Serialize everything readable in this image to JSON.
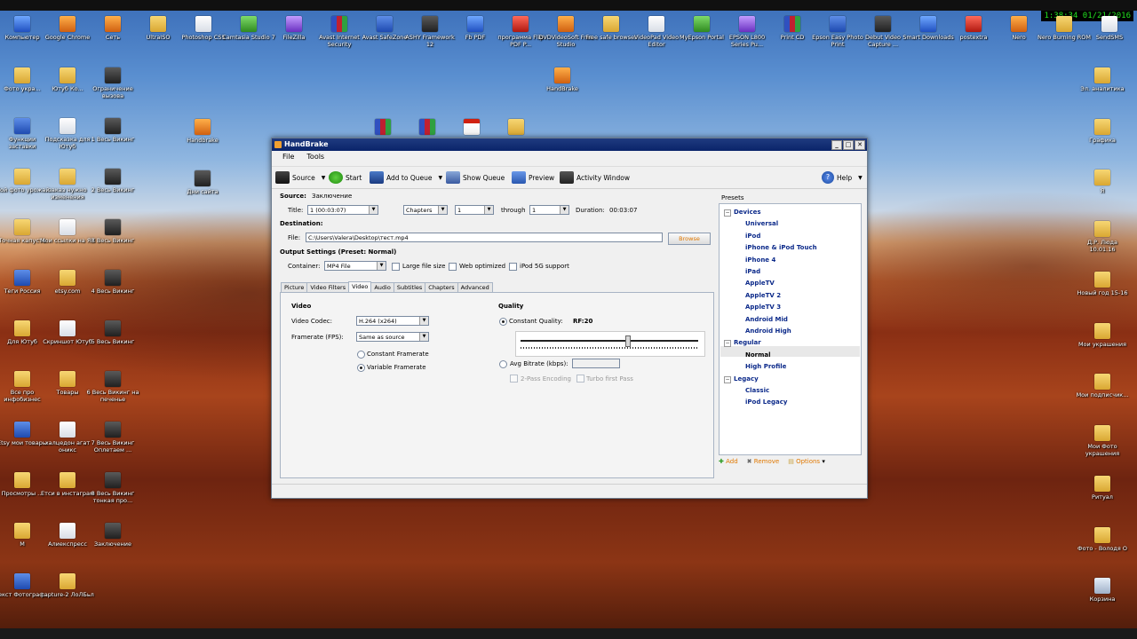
{
  "clock": "1:38:34  01/21/2016",
  "desktop_icons_top": [
    "Компьютер",
    "Google Chrome",
    "Сеть",
    "UltraISO",
    "Photoshop CS5",
    "Camtasia Studio 7",
    "FileZilla",
    "Avast Internet Security",
    "Avast SafeZone",
    "ASHY Framework 12",
    "Fb PDF",
    "программа Flip PDF P...",
    "DVDVideoSoft Free Studio",
    "Free safe browser",
    "VideoPad Video Editor",
    "MyEpson Portal",
    "EPSON L800 Series Pu...",
    "Print CD",
    "Epson Easy Photo Print",
    "Debut Video Capture ...",
    "Smart Downloads",
    "postextra",
    "Nero",
    "Nero Burning ROM",
    "SendSMS"
  ],
  "desktop_icons_left": [
    [
      "Фото укра...",
      "Ютуб Ко...",
      "Ограничение вызова"
    ],
    [
      "Функции заставки",
      "Подсказка для Ютуб",
      "1 Весь Викинг"
    ],
    [
      "Мой фото урожай",
      "заказ нужно изменения",
      "2 Весь Викинг"
    ],
    [
      "Точная капуста",
      "Мои ссылки на ЯК",
      "3 Весь Викинг"
    ],
    [
      "Теги Россия",
      "etsy.com",
      "4 Весь Викинг"
    ],
    [
      "Для Ютуб",
      "Скриншот Ютуб",
      "5 Весь Викинг"
    ],
    [
      "Все про инфобизнес",
      "Товары",
      "6 Весь Викинг на печенье"
    ],
    [
      "Etsy мои товары",
      "халцедон агат оникс",
      "7 Весь Викинг Оплетаем ..."
    ],
    [
      "Просмотры ...",
      "Етси в инстаграм",
      "8 Весь Викинг тонкая про..."
    ],
    [
      "М",
      "Алиекспресс",
      "Заключение"
    ],
    [
      "Текст Фотограф...",
      "capture-2 ЛоЛБьл",
      ""
    ]
  ],
  "desktop_icons_mid": [
    "HandBrake",
    "Дни сайта",
    "Handbrake"
  ],
  "desktop_icons_right": [
    "Эл. аналитика",
    "Графика",
    "Я",
    "Д.Р. Люда 10.01.16",
    "Новый год 15-16",
    "Мои украшения",
    "Мои подписчик...",
    "Мои Фото украшения",
    "Ритуал",
    "Фото - Володя О",
    "Корзина"
  ],
  "window": {
    "title": "HandBrake",
    "menu": [
      "File",
      "Tools"
    ],
    "toolbar": {
      "source": "Source",
      "start": "Start",
      "add_to_queue": "Add to Queue",
      "show_queue": "Show Queue",
      "preview": "Preview",
      "activity": "Activity Window",
      "help": "Help"
    },
    "source_label": "Source:",
    "source_value": "Заключение",
    "title_label": "Title:",
    "title_value": "1 (00:03:07)",
    "chapters_mode": "Chapters",
    "chapter_from": "1",
    "through_label": "through",
    "chapter_to": "1",
    "duration_label": "Duration:",
    "duration_value": "00:03:07",
    "destination_label": "Destination:",
    "file_label": "File:",
    "file_value": "C:\\Users\\Valera\\Desktop\\тест.mp4",
    "browse": "Browse",
    "output_label": "Output Settings (Preset: Normal)",
    "container_label": "Container:",
    "container_value": "MP4 File",
    "large_file": "Large file size",
    "web_optimized": "Web optimized",
    "ipod5g": "iPod 5G support",
    "tabs": [
      "Picture",
      "Video Filters",
      "Video",
      "Audio",
      "Subtitles",
      "Chapters",
      "Advanced"
    ],
    "active_tab": "Video",
    "video": {
      "section": "Video",
      "codec_label": "Video Codec:",
      "codec_value": "H.264 (x264)",
      "framerate_label": "Framerate (FPS):",
      "framerate_value": "Same as source",
      "constant_fr": "Constant Framerate",
      "variable_fr": "Variable Framerate",
      "quality_section": "Quality",
      "constant_quality": "Constant Quality:",
      "rf_value": "RF:20",
      "quality_fraction": 0.6,
      "avg_bitrate": "Avg Bitrate (kbps):",
      "two_pass": "2-Pass Encoding",
      "turbo": "Turbo first Pass"
    },
    "presets": {
      "label": "Presets",
      "groups": [
        {
          "name": "Devices",
          "items": [
            "Universal",
            "iPod",
            "iPhone & iPod Touch",
            "iPhone 4",
            "iPad",
            "AppleTV",
            "AppleTV 2",
            "AppleTV 3",
            "Android Mid",
            "Android High"
          ]
        },
        {
          "name": "Regular",
          "items": [
            "Normal",
            "High Profile"
          ]
        },
        {
          "name": "Legacy",
          "items": [
            "Classic",
            "iPod Legacy"
          ]
        }
      ],
      "selected": "Normal",
      "add": "Add",
      "remove": "Remove",
      "options": "Options"
    }
  },
  "colors": {
    "link_blue": "#0c2a8a",
    "orange": "#e07800",
    "titlebar": "#0a246a"
  }
}
